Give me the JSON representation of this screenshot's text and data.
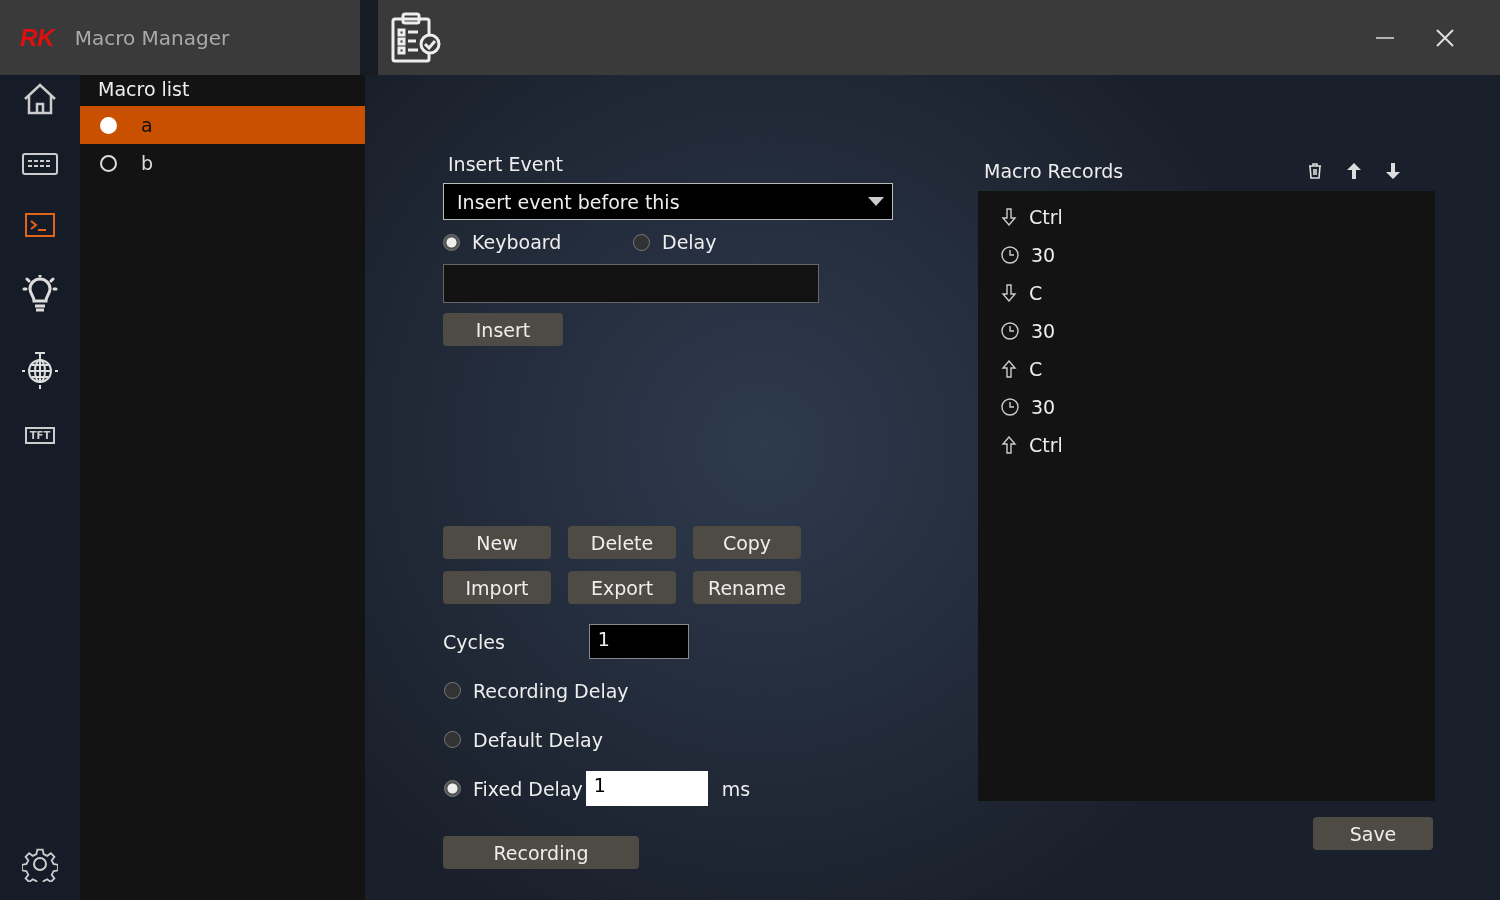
{
  "app": {
    "logo": "RK",
    "title": "Macro Manager"
  },
  "nav": {
    "tft_label": "TFT"
  },
  "macro_list": {
    "title": "Macro list",
    "items": [
      {
        "name": "a",
        "selected": true
      },
      {
        "name": "b",
        "selected": false
      }
    ]
  },
  "insert_event": {
    "title": "Insert Event",
    "position": "Insert event before this",
    "types": [
      {
        "label": "Keyboard",
        "selected": true
      },
      {
        "label": "Delay",
        "selected": false
      }
    ],
    "insert_button": "Insert"
  },
  "macro_buttons": [
    "New",
    "Delete",
    "Copy",
    "Import",
    "Export",
    "Rename"
  ],
  "cycles": {
    "label": "Cycles",
    "value": "1"
  },
  "delay_modes": [
    {
      "label": "Recording Delay",
      "selected": false
    },
    {
      "label": "Default Delay",
      "selected": false
    },
    {
      "label": "Fixed Delay",
      "selected": true,
      "value": "1",
      "unit": "ms"
    }
  ],
  "recording_button": "Recording",
  "macro_records": {
    "title": "Macro Records",
    "items": [
      {
        "kind": "down",
        "text": "Ctrl"
      },
      {
        "kind": "delay",
        "text": "30"
      },
      {
        "kind": "down",
        "text": "C"
      },
      {
        "kind": "delay",
        "text": "30"
      },
      {
        "kind": "up",
        "text": "C"
      },
      {
        "kind": "delay",
        "text": "30"
      },
      {
        "kind": "up",
        "text": "Ctrl"
      }
    ]
  },
  "save_button": "Save"
}
